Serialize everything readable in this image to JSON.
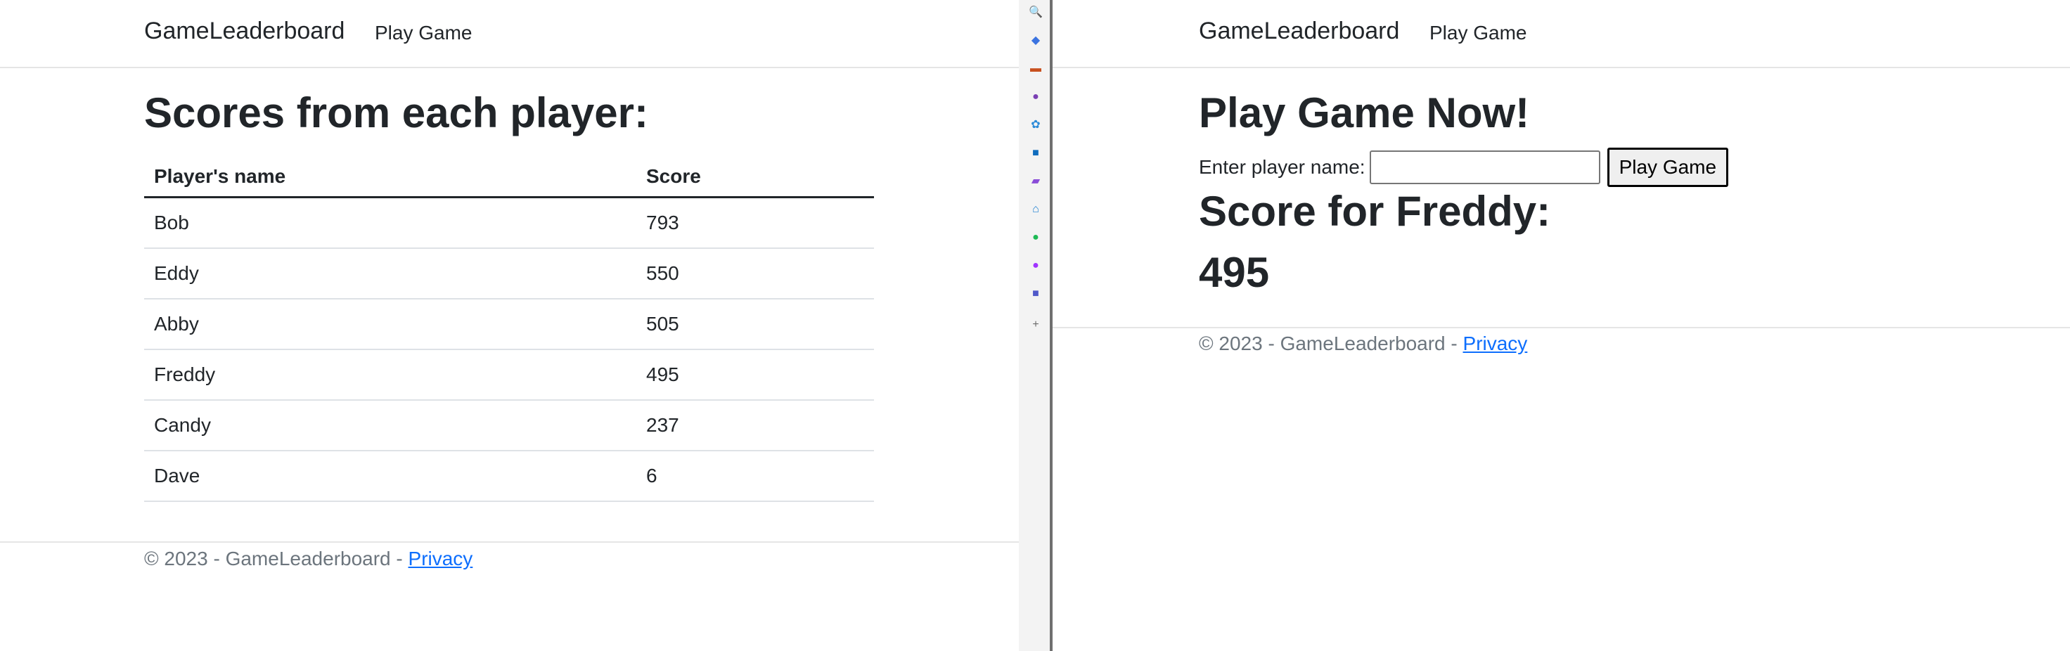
{
  "left": {
    "nav": {
      "brand": "GameLeaderboard",
      "play_link": "Play Game"
    },
    "title": "Scores from each player:",
    "table": {
      "headers": [
        "Player's name",
        "Score"
      ],
      "rows": [
        [
          "Bob",
          "793"
        ],
        [
          "Eddy",
          "550"
        ],
        [
          "Abby",
          "505"
        ],
        [
          "Freddy",
          "495"
        ],
        [
          "Candy",
          "237"
        ],
        [
          "Dave",
          "6"
        ]
      ]
    },
    "footer": {
      "text": "© 2023 - GameLeaderboard - ",
      "privacy": "Privacy"
    }
  },
  "right": {
    "nav": {
      "brand": "GameLeaderboard",
      "play_link": "Play Game"
    },
    "title": "Play Game Now!",
    "form": {
      "label": "Enter player name:",
      "input_value": "",
      "button": "Play Game"
    },
    "score_heading": "Score for Freddy:",
    "score_value": "495",
    "footer": {
      "text": "© 2023 - GameLeaderboard - ",
      "privacy": "Privacy"
    }
  },
  "sidebar_icons": [
    {
      "name": "search-icon",
      "glyph": "🔍",
      "color": "#2b6cd6"
    },
    {
      "name": "tag-icon",
      "glyph": "◆",
      "color": "#3b73e0"
    },
    {
      "name": "toolbox-icon",
      "glyph": "▬",
      "color": "#c8501e"
    },
    {
      "name": "people-icon",
      "glyph": "●",
      "color": "#7a3fb3"
    },
    {
      "name": "copilot-icon",
      "glyph": "✿",
      "color": "#2a8ad8"
    },
    {
      "name": "outlook-icon",
      "glyph": "■",
      "color": "#0f6cbd"
    },
    {
      "name": "designer-icon",
      "glyph": "▰",
      "color": "#8a4dd8"
    },
    {
      "name": "shopping-icon",
      "glyph": "⌂",
      "color": "#1b7fd1"
    },
    {
      "name": "spotify-icon",
      "glyph": "●",
      "color": "#1db954"
    },
    {
      "name": "messenger-icon",
      "glyph": "●",
      "color": "#a033ff"
    },
    {
      "name": "teams-icon",
      "glyph": "■",
      "color": "#5059c9"
    },
    {
      "name": "add-icon",
      "glyph": "+",
      "color": "#6b6b6b"
    }
  ]
}
